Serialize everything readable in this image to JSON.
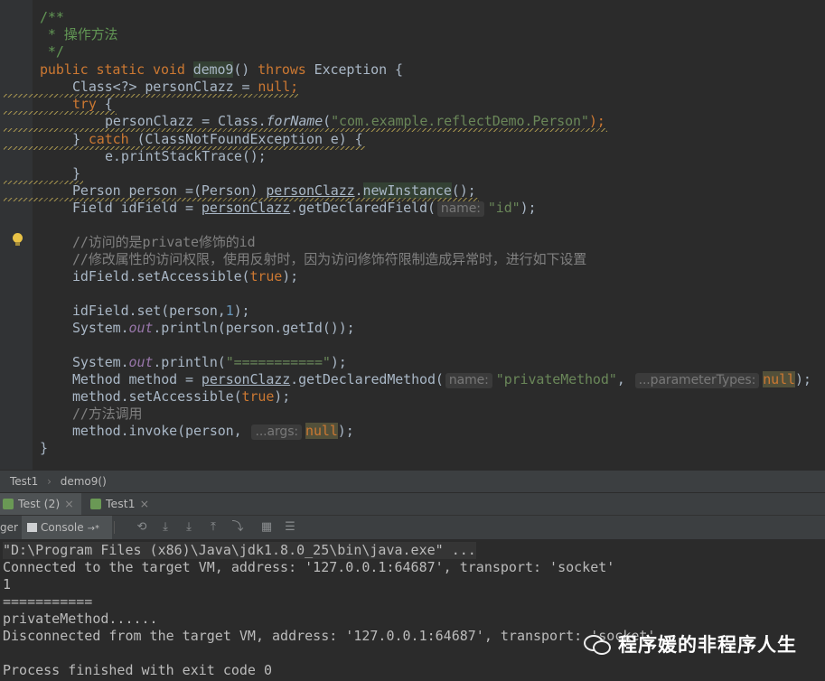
{
  "editor": {
    "lines": {
      "l1": "/**",
      "l2": " * 操作方法",
      "l3": " */",
      "l4_kw": "public static void ",
      "l4_name": "demo9",
      "l4_a": "() ",
      "l4_throws": "throws",
      "l4_b": " Exception {",
      "l5_a": "Class<?> personClazz = ",
      "l5_null": "null",
      "l5_b": ";",
      "l6_try": "try",
      "l6_b": " {",
      "l7_a": "personClazz = Class.",
      "l7_m": "forName",
      "l7_b": "(",
      "l7_str": "\"com.example.reflectDemo.Person\"",
      "l7_c": ");",
      "l8_a": "} ",
      "l8_catch": "catch",
      "l8_b": " (ClassNotFoundException e) {",
      "l9": "e.printStackTrace();",
      "l10": "}",
      "l11_a": "Person person =(Person) ",
      "l11_b": "personClazz",
      "l11_c": ".",
      "l11_d": "newInstance",
      "l11_e": "();",
      "l12_a": "Field idField = ",
      "l12_b": "personClazz",
      "l12_c": ".getDeclaredField(",
      "l12_hint": "name:",
      "l12_str": "\"id\"",
      "l12_d": ");",
      "l14": "//访问的是private修饰的id",
      "l15": "//修改属性的访问权限，使用反射时，因为访问修饰符限制造成异常时，进行如下设置",
      "l16_a": "idField.setAccessible(",
      "l16_true": "true",
      "l16_b": ");",
      "l18_a": "idField.set(person,",
      "l18_num": "1",
      "l18_b": ");",
      "l19_a": "System.",
      "l19_out": "out",
      "l19_b": ".println(person.getId());",
      "l21_a": "System.",
      "l21_out": "out",
      "l21_b": ".println(",
      "l21_str": "\"===========\"",
      "l21_c": ");",
      "l22_a": "Method method = ",
      "l22_b": "personClazz",
      "l22_c": ".getDeclaredMethod(",
      "l22_hint1": "name:",
      "l22_str": "\"privateMethod\"",
      "l22_comma": ", ",
      "l22_hint2": "...parameterTypes:",
      "l22_null": "null",
      "l22_d": ");",
      "l23_a": "method.setAccessible(",
      "l23_true": "true",
      "l23_b": ");",
      "l24": "//方法调用",
      "l25_a": "method.invoke(person, ",
      "l25_hint": "...args:",
      "l25_null": "null",
      "l25_b": ");",
      "l26": "}"
    }
  },
  "breadcrumb": {
    "class": "Test1",
    "sep": "›",
    "method": "demo9()"
  },
  "run_tabs": {
    "tab1": "Test (2)",
    "tab2": "Test1",
    "close": "×"
  },
  "toolbar": {
    "debugger": "ger",
    "console": "Console",
    "console_arrow": "→*"
  },
  "console": {
    "lines": [
      "\"D:\\Program Files (x86)\\Java\\jdk1.8.0_25\\bin\\java.exe\" ...",
      "Connected to the target VM, address: '127.0.0.1:64687', transport: 'socket'",
      "1",
      "===========",
      "privateMethod......",
      "Disconnected from the target VM, address: '127.0.0.1:64687', transport: 'socket'",
      "",
      "Process finished with exit code 0"
    ]
  },
  "watermark": {
    "text": "程序媛的非程序人生"
  },
  "colors": {
    "background": "#2b2b2b",
    "keyword": "#cc7832",
    "string": "#6a8759",
    "doc_comment": "#629755",
    "panel": "#3c3f41"
  }
}
